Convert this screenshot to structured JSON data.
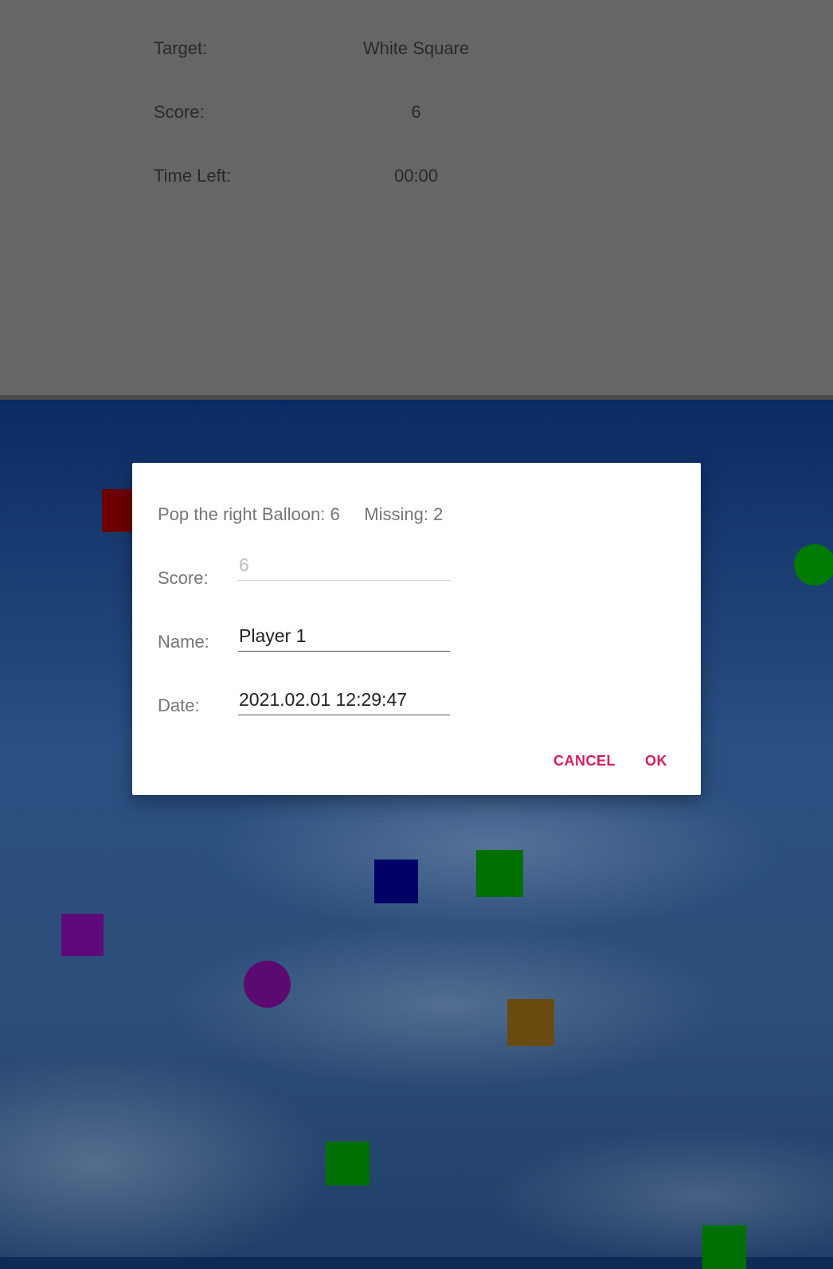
{
  "status": {
    "target_label": "Target:",
    "target_value": "White Square",
    "score_label": "Score:",
    "score_value": "6",
    "time_label": "Time Left:",
    "time_value": "00:00"
  },
  "dialog": {
    "message": "Pop the right Balloon: 6     Missing: 2",
    "score_label": "Score:",
    "score_value": "6",
    "name_label": "Name:",
    "name_value": "Player 1",
    "date_label": "Date:",
    "date_value": "2021.02.01 12:29:47",
    "cancel_label": "CANCEL",
    "ok_label": "OK"
  },
  "balloons": [
    {
      "shape": "square",
      "color": "#6e0000"
    },
    {
      "shape": "circle",
      "color": "#007a00"
    },
    {
      "shape": "square",
      "color": "#000066"
    },
    {
      "shape": "square",
      "color": "#007000"
    },
    {
      "shape": "square",
      "color": "#5f0a7a"
    },
    {
      "shape": "circle",
      "color": "#5a0a70"
    },
    {
      "shape": "square",
      "color": "#6b4a10"
    },
    {
      "shape": "square",
      "color": "#007000"
    },
    {
      "shape": "square",
      "color": "#007000"
    }
  ]
}
